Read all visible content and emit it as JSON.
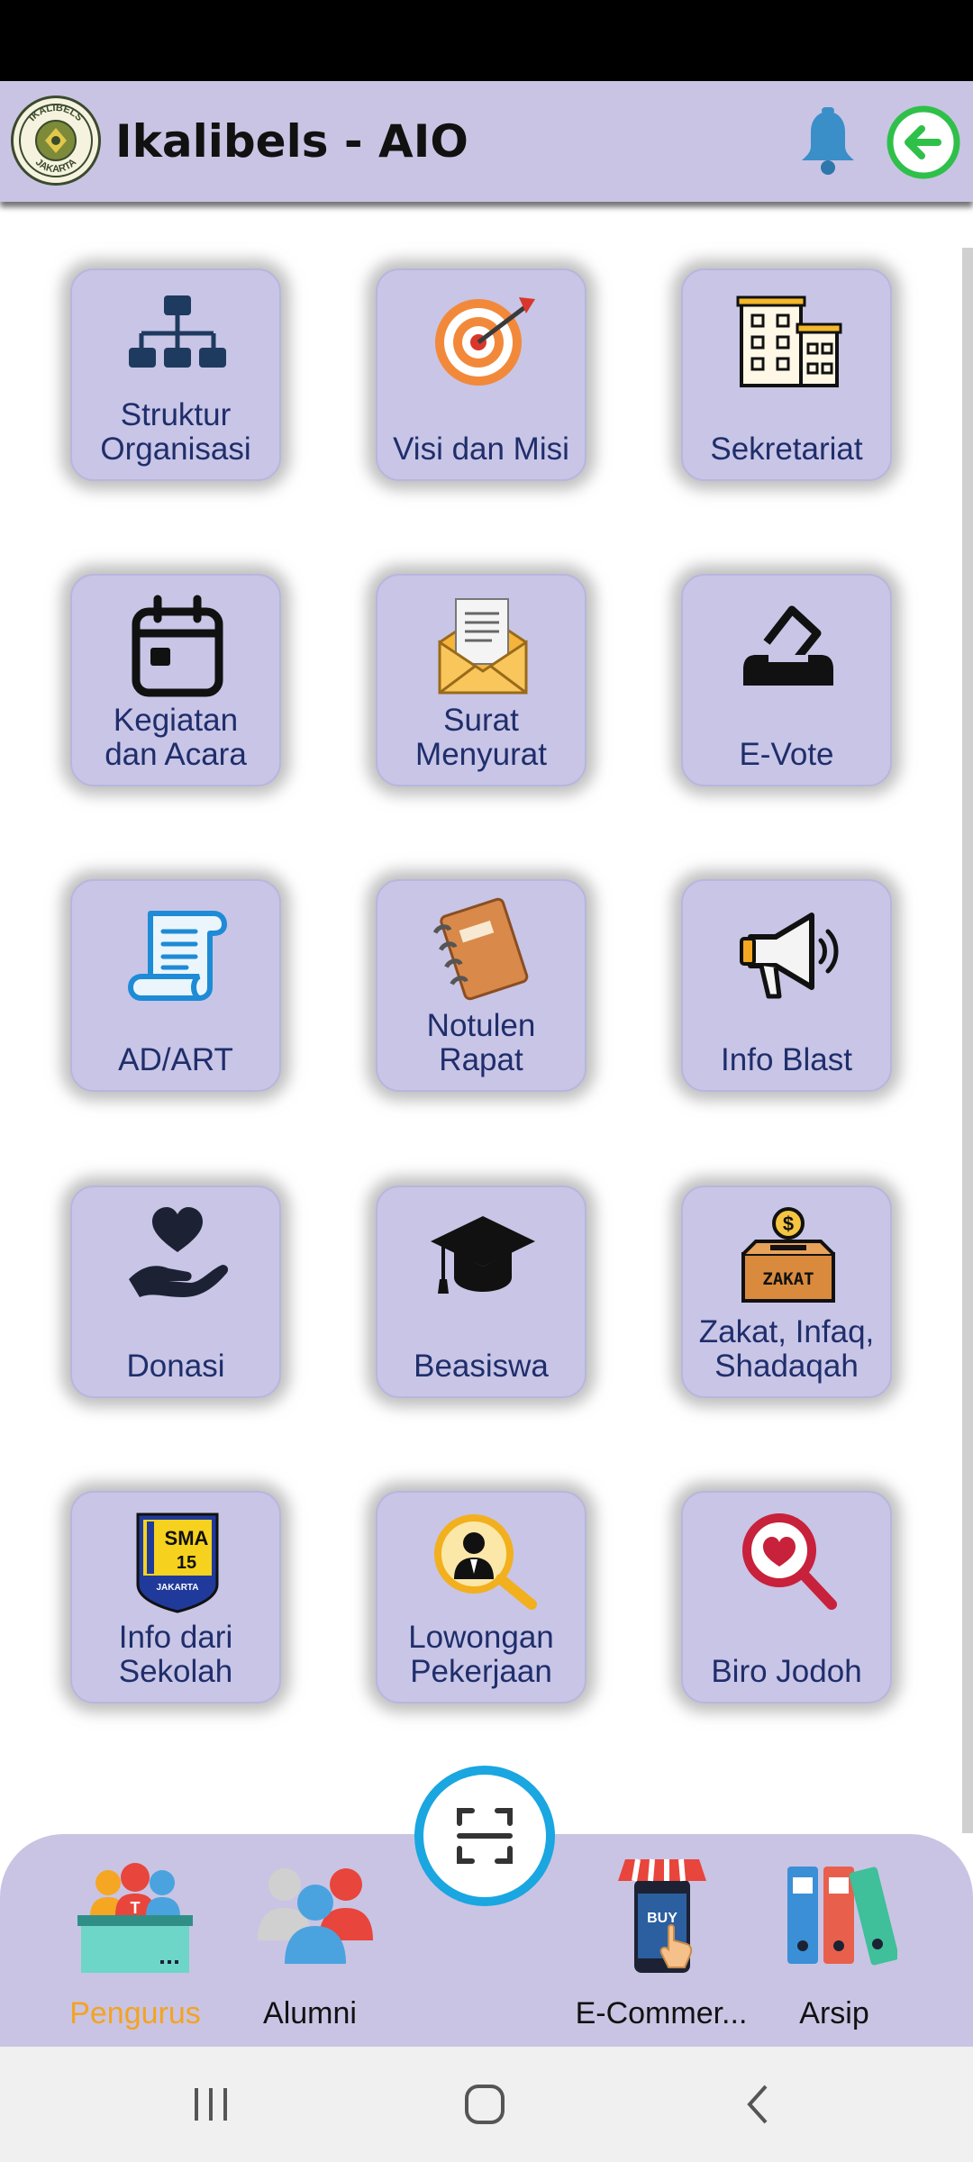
{
  "app_bar": {
    "title": "Ikalibels - AIO",
    "logo_top_text": "IKALIBELS",
    "logo_bottom_text": "JAKARTA"
  },
  "menu": [
    {
      "lines": [
        "Struktur",
        "Organisasi"
      ],
      "icon": "org-chart-icon"
    },
    {
      "lines": [
        "Visi dan Misi"
      ],
      "icon": "target-icon"
    },
    {
      "lines": [
        "Sekretariat"
      ],
      "icon": "building-icon"
    },
    {
      "lines": [
        "Kegiatan",
        "dan Acara"
      ],
      "icon": "calendar-icon"
    },
    {
      "lines": [
        "Surat",
        "Menyurat"
      ],
      "icon": "envelope-icon"
    },
    {
      "lines": [
        "E-Vote"
      ],
      "icon": "ballot-box-icon"
    },
    {
      "lines": [
        "AD/ART"
      ],
      "icon": "scroll-icon"
    },
    {
      "lines": [
        "Notulen",
        "Rapat"
      ],
      "icon": "notebook-icon"
    },
    {
      "lines": [
        "Info Blast"
      ],
      "icon": "megaphone-icon"
    },
    {
      "lines": [
        "Donasi"
      ],
      "icon": "heart-hand-icon"
    },
    {
      "lines": [
        "Beasiswa"
      ],
      "icon": "graduation-cap-icon"
    },
    {
      "lines": [
        "Zakat, Infaq,",
        "Shadaqah"
      ],
      "icon": "zakat-box-icon",
      "badge": "ZAKAT"
    },
    {
      "lines": [
        "Info dari",
        "Sekolah"
      ],
      "icon": "school-badge-icon",
      "badge_top": "SMA",
      "badge_num": "15",
      "badge_bottom": "JAKARTA"
    },
    {
      "lines": [
        "Lowongan",
        "Pekerjaan"
      ],
      "icon": "job-search-icon"
    },
    {
      "lines": [
        "Biro Jodoh"
      ],
      "icon": "heart-search-icon"
    }
  ],
  "bottom_nav": [
    {
      "label": "Pengurus",
      "active": true,
      "icon": "committee-icon"
    },
    {
      "label": "Alumni",
      "active": false,
      "icon": "people-icon"
    },
    {
      "label": "E-Commer...",
      "active": false,
      "icon": "shop-icon",
      "badge": "BUY"
    },
    {
      "label": "Arsip",
      "active": false,
      "icon": "binders-icon"
    }
  ],
  "colors": {
    "accent": "#f4a321",
    "tile_bg": "#c8c5e6",
    "label": "#1f2e6b",
    "bar_bg": "#c9c4e3",
    "scan_ring": "#1aa6e0"
  }
}
